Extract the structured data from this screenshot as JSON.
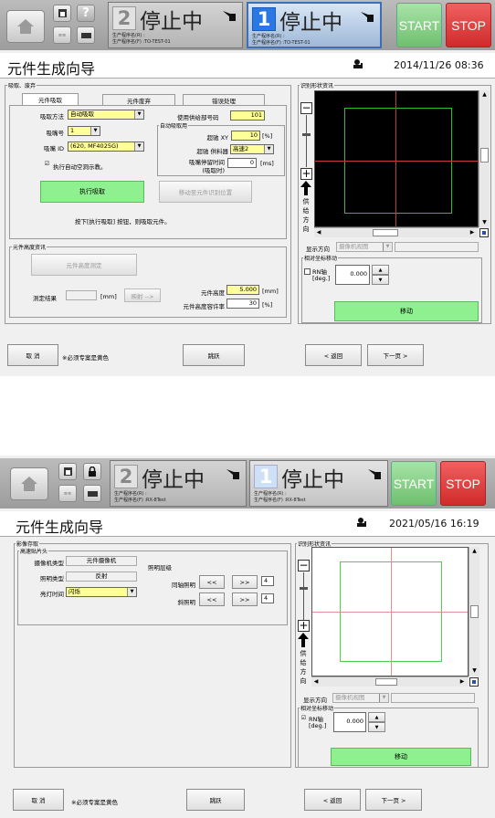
{
  "screens": [
    {
      "lane1": {
        "num": "2",
        "status": "停止中",
        "sub1": "生产程序名(R) :",
        "sub2": "生产程序名(F) :TO-TEST-01"
      },
      "lane2": {
        "num": "1",
        "status": "停止中",
        "sub1": "生产程序名(R) :",
        "sub2": "生产程序名(F) :TO-TEST-01"
      },
      "start": "START",
      "stop": "STOP",
      "title": "元件生成向导",
      "datetime": "2014/11/26 08:36",
      "group_main": "吸取、废弃",
      "tabs": [
        "元件吸取",
        "元件废弃",
        "错误处理"
      ],
      "suction_method_label": "吸取方法",
      "suction_method_value": "自动吸取",
      "nozzle_label": "吸嘴号",
      "nozzle_value": "1",
      "nozzle_id_label": "吸嘴 ID",
      "nozzle_id_value": "(620, MF4025G)",
      "auto_empty_label": "执行自动空洞示教。",
      "feeder_label": "使用供给部号码",
      "feeder_value": "101",
      "auto_suction_group": "自动吸取用",
      "xy_label": "超驰 XY",
      "xy_value": "10",
      "xy_unit": "[%]",
      "feeder_speed_label": "超驰 供料器",
      "feeder_speed_value": "高速2",
      "wait_label": "吸嘴停留时间",
      "wait_label2": "(吸取时)",
      "wait_value": "0",
      "wait_unit": "[ms]",
      "exec_button": "执行吸取",
      "move_button": "移动至元件识别位置",
      "instruction": "按下[执行吸取] 按钮，则吸取元件。",
      "height_group": "元件高度资讯",
      "height_measure_button": "元件高度测定",
      "measure_result_label": "测定结果",
      "measure_unit": "[mm]",
      "map_button": "映射 -->",
      "part_height_label": "元件高度",
      "part_height_value": "5.000",
      "part_height_unit": "[mm]",
      "tolerance_label": "元件高度容许率",
      "tolerance_value": "30",
      "tolerance_unit": "[%]",
      "shape_group": "识别形状资讯",
      "side_text": [
        "供",
        "给",
        "方",
        "向"
      ],
      "display_dir_label": "显示方向",
      "display_dir_value": "摄像机视图",
      "relative_group": "相对坐标移动",
      "rn_label": "RN轴",
      "rn_unit": "[deg.]",
      "rn_value": "0.000",
      "move_exec": "移动",
      "cancel": "取 消",
      "yellow_note": "※必须专案是黄色",
      "skip": "跳跃",
      "back": "< 返回",
      "next": "下一页 >"
    },
    {
      "lane1": {
        "num": "2",
        "status": "停止中",
        "sub1": "生产程序名(R) :",
        "sub2": "生产程序名(F) :RX-8Test"
      },
      "lane2": {
        "num": "1",
        "status": "停止中",
        "sub1": "生产程序名(R) :",
        "sub2": "生产程序名(F) :RX-8Test"
      },
      "start": "START",
      "stop": "STOP",
      "title": "元件生成向导",
      "datetime": "2021/05/16 16:19",
      "group_main": "影像存取",
      "sub_group": "高速贴片头",
      "camera_type_label": "摄像机类型",
      "camera_type_value": "元件摄像机",
      "light_type_label": "照明类型",
      "light_type_value": "反射",
      "light_time_label": "亮灯时间",
      "light_time_value": "闪烁",
      "light_level_label": "照明层级",
      "coaxial_label": "同轴照明",
      "coaxial_value": "4",
      "oblique_label": "斜照明",
      "oblique_value": "4",
      "dec_button": "<<",
      "inc_button": ">>",
      "shape_group": "识别形状资讯",
      "side_text": [
        "供",
        "给",
        "方",
        "向"
      ],
      "display_dir_label": "显示方向",
      "display_dir_value": "摄像机视图",
      "relative_group": "相对坐标移动",
      "rn_label": "RN轴",
      "rn_unit": "[deg.]",
      "rn_value": "0.000",
      "move_exec": "移动",
      "cancel": "取 消",
      "yellow_note": "※必须专案是黄色",
      "skip": "跳跃",
      "back": "< 返回",
      "next": "下一页 >"
    }
  ]
}
